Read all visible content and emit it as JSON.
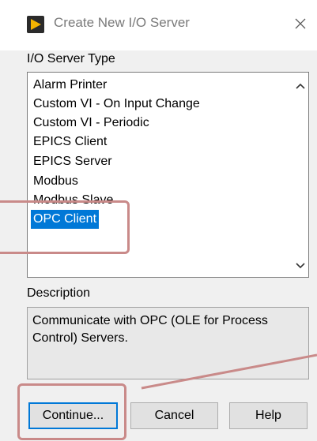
{
  "window": {
    "title": "Create New I/O Server"
  },
  "server_type": {
    "label": "I/O Server Type",
    "items": [
      "Alarm Printer",
      "Custom VI - On Input Change",
      "Custom VI - Periodic",
      "EPICS Client",
      "EPICS Server",
      "Modbus",
      "Modbus Slave",
      "OPC Client"
    ],
    "selected": "OPC Client"
  },
  "description": {
    "label": "Description",
    "text": "Communicate with OPC (OLE for Process Control) Servers."
  },
  "buttons": {
    "continue": "Continue...",
    "cancel": "Cancel",
    "help": "Help"
  },
  "colors": {
    "selection": "#0078d7",
    "highlight_annotation": "#c98a89",
    "app_icon_arrow": "#f5b400"
  },
  "icons": {
    "app": "labview-run-arrow-icon",
    "close": "close-icon",
    "scroll_up": "chevron-up-icon",
    "scroll_down": "chevron-down-icon"
  }
}
